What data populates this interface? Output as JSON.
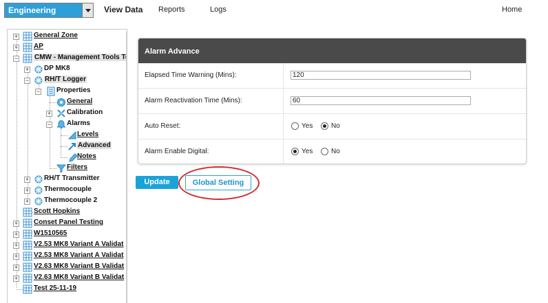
{
  "header": {
    "department": "Engineering",
    "nav": [
      "View Data",
      "Reports",
      "Logs",
      "Home"
    ]
  },
  "tree": [
    {
      "label": "General Zone"
    },
    {
      "label": "AP"
    },
    {
      "label": "CMW - Management Tools Te"
    },
    {
      "label": "DP MK8"
    },
    {
      "label": "RH/T Logger"
    },
    {
      "label": "Properties"
    },
    {
      "label": "General"
    },
    {
      "label": "Calibration"
    },
    {
      "label": "Alarms"
    },
    {
      "label": "Levels"
    },
    {
      "label": "Advanced"
    },
    {
      "label": "Notes"
    },
    {
      "label": "Filters"
    },
    {
      "label": "RH/T Transmitter"
    },
    {
      "label": "Thermocouple"
    },
    {
      "label": "Thermocouple 2"
    },
    {
      "label": "Scott Hopkins"
    },
    {
      "label": "Conset Panel Testing"
    },
    {
      "label": "W1510565"
    },
    {
      "label": "V2.53 MK8 Variant A Validat"
    },
    {
      "label": "V2.53 MK8 Variant A Validat"
    },
    {
      "label": "V2.63 MK8 Variant B Validat"
    },
    {
      "label": "V2.63 MK8 Variant B Validat"
    },
    {
      "label": "Test 25-11-19"
    }
  ],
  "alarm_panel": {
    "title": "Alarm Advance",
    "elapsed_label": "Elapsed Time Warning (Mins):",
    "elapsed_value": "120",
    "reactivation_label": "Alarm Reactivation Time (Mins):",
    "reactivation_value": "60",
    "auto_reset_label": "Auto Reset:",
    "auto_reset_selected": "No",
    "enable_digital_label": "Alarm Enable Digital:",
    "enable_digital_selected": "Yes",
    "yes": "Yes",
    "no": "No"
  },
  "buttons": {
    "update": "Update",
    "global_setting": "Global Setting"
  },
  "annotation_color": "#d42b2b",
  "accent_color": "#1aa3d9"
}
